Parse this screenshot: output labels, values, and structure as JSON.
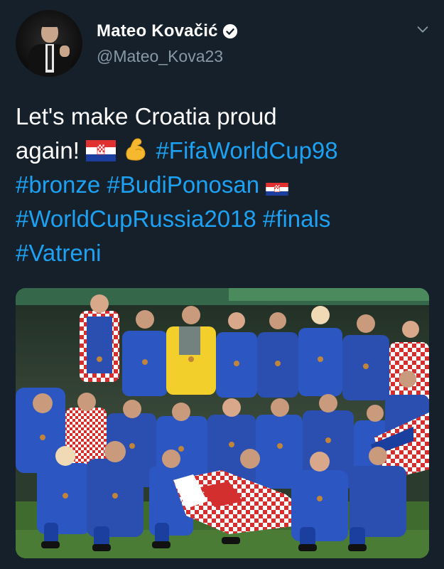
{
  "author": {
    "display_name": "Mateo Kovačić",
    "handle": "@Mateo_Kova23",
    "avatar_icon": "profile-photo-man-in-suit-thumbs-up",
    "verified_icon": "verified-badge-icon"
  },
  "menu": {
    "icon": "chevron-down-icon"
  },
  "tweet": {
    "line1": "Let's make Croatia proud",
    "line2_text": "again!",
    "line2_tag": "#FifaWorldCup98",
    "line3_tag1": "#bronze",
    "line3_tag2": "#BudiPonosan",
    "line4_tag1": "#WorldCupRussia2018",
    "line4_tag2": "#finals",
    "line5_tag": "#Vatreni",
    "emoji": [
      "croatia-flag",
      "flexed-biceps",
      "croatia-flag"
    ]
  },
  "media": {
    "type": "photo",
    "subject": "team-photo-croatia-1998"
  },
  "colors": {
    "background": "#15202b",
    "text": "#ffffff",
    "secondary": "#8899a6",
    "link": "#1da1f2"
  }
}
